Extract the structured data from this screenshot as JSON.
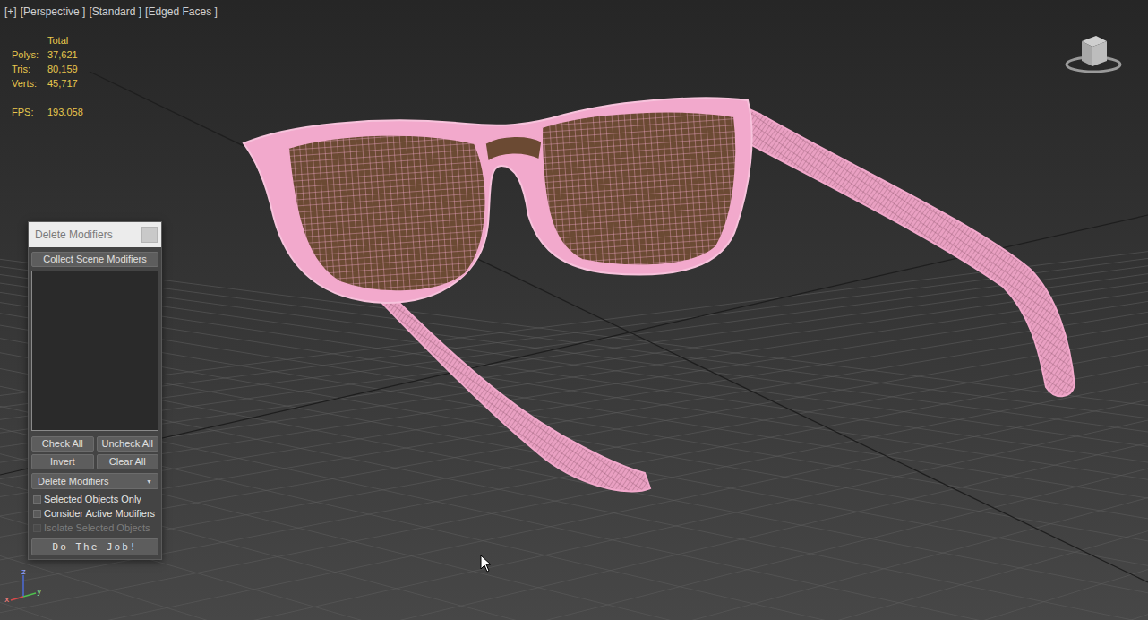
{
  "viewport": {
    "labels": [
      "[+]",
      "[Perspective ]",
      "[Standard ]",
      "[Edged Faces ]"
    ]
  },
  "stats": {
    "header": "Total",
    "rows": [
      {
        "label": "Polys:",
        "value": "37,621"
      },
      {
        "label": "Tris:",
        "value": "80,159"
      },
      {
        "label": "Verts:",
        "value": "45,717"
      }
    ],
    "fps": {
      "label": "FPS:",
      "value": "193.058"
    }
  },
  "dialog": {
    "title": "Delete Modifiers",
    "collect_button": "Collect Scene Modifiers",
    "modifier_list": [],
    "buttons": [
      "Check All",
      "Uncheck All",
      "Invert",
      "Clear All"
    ],
    "mode": {
      "value": "Delete Modifiers",
      "arrow": "▼"
    },
    "options": [
      {
        "label": "Selected Objects Only",
        "checked": false,
        "disabled": false
      },
      {
        "label": "Consider Active Modifiers",
        "checked": false,
        "disabled": false
      },
      {
        "label": "Isolate Selected Objects",
        "checked": false,
        "disabled": true
      }
    ],
    "run_button": "Do The Job!"
  },
  "axis_gizmo": {
    "labels": [
      "z",
      "x",
      "y"
    ]
  }
}
